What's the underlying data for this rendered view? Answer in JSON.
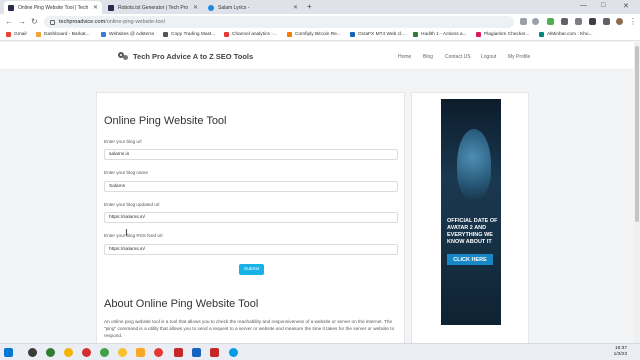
{
  "browser": {
    "tabs": [
      {
        "title": "Online Ping Website Tool | Tech"
      },
      {
        "title": "Robots.txt Generator | Tech Pro"
      },
      {
        "title": "Salam Lyrics -"
      }
    ],
    "url_host": "techproadvice.com",
    "url_path": "/online-ping-website-tool",
    "bookmarks": [
      "Gmail",
      "Dashboard - Barkat...",
      "Websites @ Adsterra",
      "Copy Trading Mast...",
      "Channel analytics -...",
      "Comfiply Bitcoin Re...",
      "OctaFX MT4 Web cl...",
      "Hadith 1 - Actions a...",
      "Plagiarism Checker...",
      "AlMinbar.com : Khu..."
    ]
  },
  "site": {
    "brand": "Tech Pro Advice A to Z SEO Tools",
    "nav": [
      "Home",
      "Blog",
      "Contact US",
      "Logout",
      "My Profile"
    ]
  },
  "tool": {
    "title": "Online Ping Website Tool",
    "fields": [
      {
        "label": "Enter your blog url",
        "value": "salams.in"
      },
      {
        "label": "Enter your blog name",
        "value": "Salams"
      },
      {
        "label": "Enter your blog updated url",
        "value": "https://salams.in/"
      },
      {
        "label": "Enter your blog RSS feed url",
        "value": "https://salams.in/"
      }
    ],
    "submit_label": "Submit"
  },
  "about": {
    "title": "About Online Ping Website Tool",
    "text": "An online ping website tool is a tool that allows you to check the reachability and responsiveness of a website or server on the internet. The \"ping\" command is a utility that allows you to send a request to a server or website and measure the time it takes for the server or website to respond."
  },
  "ad": {
    "text": "OFFICIAL DATE OF AVATAR 2 AND EVERYTHING WE KNOW ABOUT IT",
    "button": "CLICK HERE"
  },
  "clock": {
    "time": "16:37",
    "date": "1/3/23"
  },
  "colors": {
    "accent": "#17b3e6",
    "ad_button": "#1787c6"
  }
}
